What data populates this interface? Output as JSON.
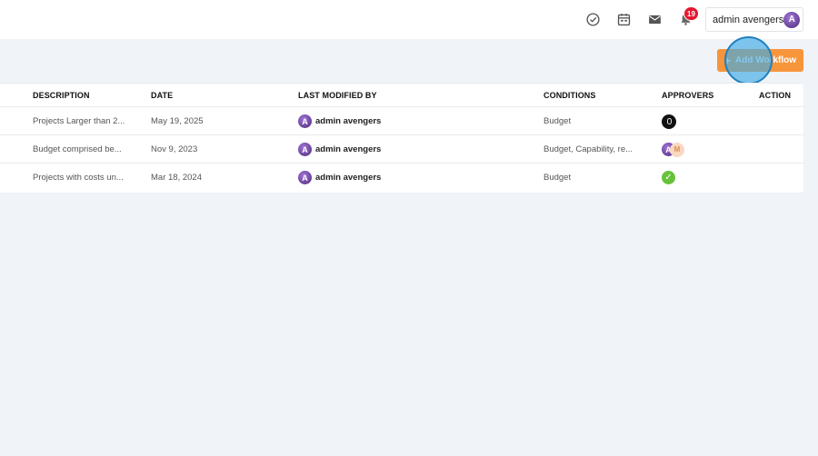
{
  "topbar": {
    "icons": [
      "check-circle-icon",
      "calendar-icon",
      "mail-icon",
      "bell-icon"
    ],
    "notification_count": "19",
    "user_name": "admin avengers",
    "user_initial": "A"
  },
  "actions": {
    "add_label": "Add Workflow",
    "add_icon": "+"
  },
  "table": {
    "headers": {
      "description": "DESCRIPTION",
      "date": "DATE",
      "modified_by": "LAST MODIFIED BY",
      "conditions": "CONDITIONS",
      "approvers": "APPROVERS",
      "action": "ACTION"
    },
    "rows": [
      {
        "description": "Projects Larger than 2...",
        "date": "May 19, 2025",
        "modified_by": "admin avengers",
        "conditions": "Budget",
        "approvers": [
          "dark-avatar"
        ]
      },
      {
        "description": "Budget comprised be...",
        "date": "Nov 9, 2023",
        "modified_by": "admin avengers",
        "conditions": "Budget, Capability, re...",
        "approvers": [
          "A",
          "M"
        ]
      },
      {
        "description": "Projects with costs un...",
        "date": "Mar 18, 2024",
        "modified_by": "admin avengers",
        "conditions": "Budget",
        "approvers": [
          "check"
        ]
      }
    ]
  },
  "colors": {
    "accent": "#f7953b",
    "badge": "#e4172f",
    "background": "#f0f3f7",
    "approved": "#67c23a"
  }
}
